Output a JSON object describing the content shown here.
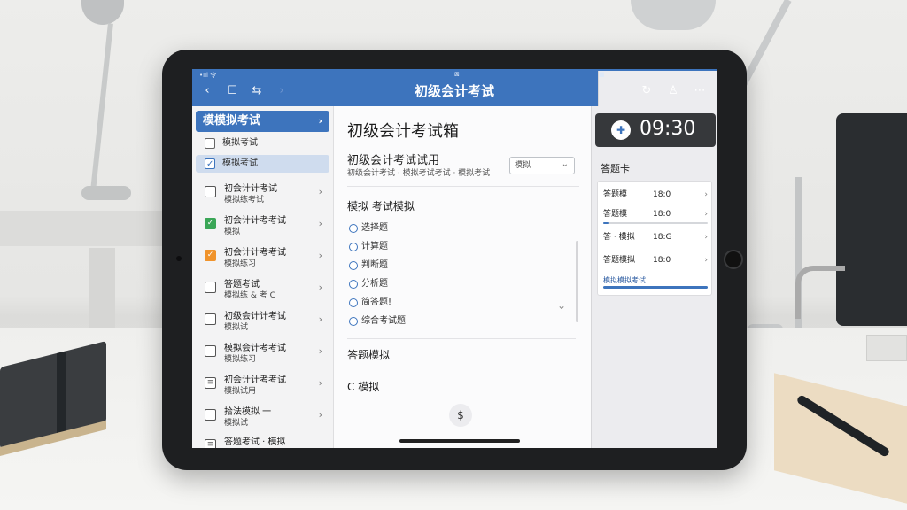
{
  "status_bar": {
    "left": "•ııl 令",
    "center": "⊠",
    "right": "■"
  },
  "nav": {
    "back_icon": "chevron-left-icon",
    "title": "初级会计考试"
  },
  "sidebar": {
    "header": "模模拟考试",
    "subitems": [
      {
        "label": "模拟考试",
        "selected": false
      },
      {
        "label": "模拟考试",
        "selected": true
      }
    ],
    "items": [
      {
        "line1": "初会计计考试",
        "line2": "模拟练考试",
        "status": "empty"
      },
      {
        "line1": "初会计计考考试",
        "line2": "模拟",
        "status": "done"
      },
      {
        "line1": "初会计计考考试",
        "line2": "模拟练习",
        "status": "flag"
      },
      {
        "line1": "答题考试",
        "line2": "模拟练 & 考 C",
        "status": "empty"
      },
      {
        "line1": "初级会计计考试",
        "line2": "模拟试",
        "status": "empty"
      },
      {
        "line1": "模拟会计考考试",
        "line2": "模拟练习",
        "status": "empty"
      },
      {
        "line1": "初会计计考考试",
        "line2": "模拟试用",
        "status": "doc"
      },
      {
        "line1": "拾法模拟 一",
        "line2": "模拟试",
        "status": "empty"
      },
      {
        "line1": "答题考试 · 模拟",
        "line2": "",
        "status": "doc"
      }
    ]
  },
  "main": {
    "title": "初级会计考试箱",
    "subtitle": "初级会计考试试用",
    "subtitle_small": "初级会计考试 · 模拟考试考试 · 模拟考试",
    "select_value": "模拟",
    "question_heading": "模拟 考试模拟",
    "options": [
      "选择题",
      "计算题",
      "判断题",
      "分析题",
      "简答题!",
      "综合考试题"
    ],
    "section1": "答题模拟",
    "section2": "C 模拟",
    "dollar_icon": "$"
  },
  "right": {
    "timer": "09:30",
    "label": "答题卡",
    "rows": [
      {
        "k": "答题模",
        "v": "18:0",
        "progress": 0
      },
      {
        "k": "答题模",
        "v": "18:0",
        "progress": 0.05
      },
      {
        "k": "答 · 模拟",
        "v": "18:G",
        "progress": 0
      },
      {
        "k": "答题模拟",
        "v": "18:0",
        "progress": 0
      }
    ],
    "footer": "模拟模拟考试",
    "footer_progress": 1
  },
  "colors": {
    "accent": "#3d74bd",
    "done": "#3aa657",
    "flag": "#f0932b"
  }
}
